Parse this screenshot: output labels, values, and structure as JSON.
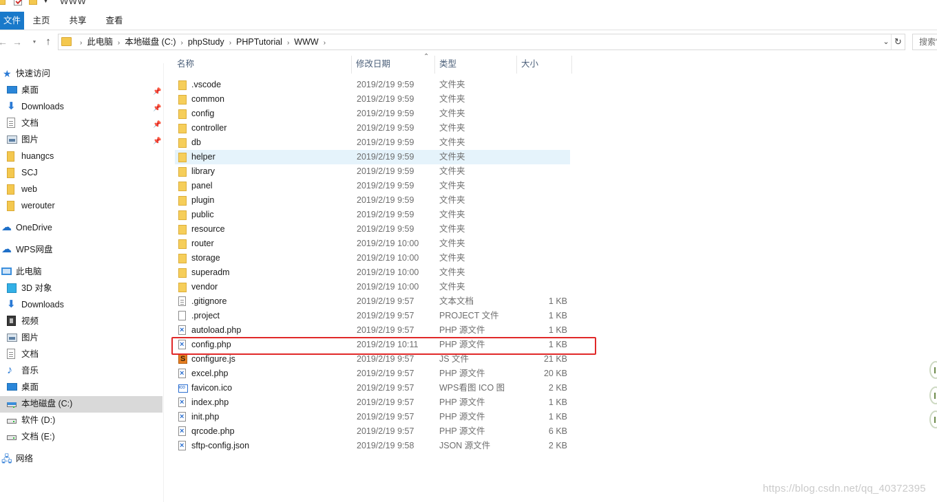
{
  "window": {
    "title": "WWW"
  },
  "ribbon": {
    "tabs": [
      "文件",
      "主页",
      "共享",
      "查看"
    ]
  },
  "address": {
    "segments": [
      "此电脑",
      "本地磁盘 (C:)",
      "phpStudy",
      "PHPTutorial",
      "WWW"
    ],
    "search_placeholder": "搜索\"WWW\""
  },
  "sidebar": {
    "items": [
      {
        "label": "快速访问",
        "icon": "star-icon"
      },
      {
        "label": "桌面",
        "icon": "desktop-icon",
        "pinned": true
      },
      {
        "label": "Downloads",
        "icon": "download-arrow-icon",
        "pinned": true
      },
      {
        "label": "文档",
        "icon": "document-icon",
        "pinned": true
      },
      {
        "label": "图片",
        "icon": "picture-icon",
        "pinned": true
      },
      {
        "label": "huangcs",
        "icon": "folder-icon"
      },
      {
        "label": "SCJ",
        "icon": "folder-icon"
      },
      {
        "label": "web",
        "icon": "folder-icon"
      },
      {
        "label": "werouter",
        "icon": "folder-icon"
      },
      {
        "label": "OneDrive",
        "icon": "cloud-icon"
      },
      {
        "label": "WPS网盘",
        "icon": "wps-cloud-icon"
      },
      {
        "label": "此电脑",
        "icon": "computer-icon"
      },
      {
        "label": "3D 对象",
        "icon": "3d-objects-icon"
      },
      {
        "label": "Downloads",
        "icon": "download-arrow-icon"
      },
      {
        "label": "视频",
        "icon": "video-icon"
      },
      {
        "label": "图片",
        "icon": "picture-icon"
      },
      {
        "label": "文档",
        "icon": "document-icon"
      },
      {
        "label": "音乐",
        "icon": "music-icon"
      },
      {
        "label": "桌面",
        "icon": "desktop-icon"
      },
      {
        "label": "本地磁盘 (C:)",
        "icon": "system-drive-icon",
        "selected": true
      },
      {
        "label": "软件 (D:)",
        "icon": "drive-icon"
      },
      {
        "label": "文档 (E:)",
        "icon": "drive-icon"
      },
      {
        "label": "网络",
        "icon": "network-icon"
      }
    ]
  },
  "columns": {
    "name": "名称",
    "date": "修改日期",
    "type": "类型",
    "size": "大小"
  },
  "files": [
    {
      "name": ".vscode",
      "date": "2019/2/19 9:59",
      "type": "文件夹",
      "size": "",
      "icon": "folder-icon"
    },
    {
      "name": "common",
      "date": "2019/2/19 9:59",
      "type": "文件夹",
      "size": "",
      "icon": "folder-icon"
    },
    {
      "name": "config",
      "date": "2019/2/19 9:59",
      "type": "文件夹",
      "size": "",
      "icon": "folder-icon"
    },
    {
      "name": "controller",
      "date": "2019/2/19 9:59",
      "type": "文件夹",
      "size": "",
      "icon": "folder-icon"
    },
    {
      "name": "db",
      "date": "2019/2/19 9:59",
      "type": "文件夹",
      "size": "",
      "icon": "folder-icon"
    },
    {
      "name": "helper",
      "date": "2019/2/19 9:59",
      "type": "文件夹",
      "size": "",
      "icon": "folder-icon",
      "hover": true
    },
    {
      "name": "library",
      "date": "2019/2/19 9:59",
      "type": "文件夹",
      "size": "",
      "icon": "folder-icon"
    },
    {
      "name": "panel",
      "date": "2019/2/19 9:59",
      "type": "文件夹",
      "size": "",
      "icon": "folder-icon"
    },
    {
      "name": "plugin",
      "date": "2019/2/19 9:59",
      "type": "文件夹",
      "size": "",
      "icon": "folder-icon"
    },
    {
      "name": "public",
      "date": "2019/2/19 9:59",
      "type": "文件夹",
      "size": "",
      "icon": "folder-icon"
    },
    {
      "name": "resource",
      "date": "2019/2/19 9:59",
      "type": "文件夹",
      "size": "",
      "icon": "folder-icon"
    },
    {
      "name": "router",
      "date": "2019/2/19 10:00",
      "type": "文件夹",
      "size": "",
      "icon": "folder-icon"
    },
    {
      "name": "storage",
      "date": "2019/2/19 10:00",
      "type": "文件夹",
      "size": "",
      "icon": "folder-icon"
    },
    {
      "name": "superadm",
      "date": "2019/2/19 10:00",
      "type": "文件夹",
      "size": "",
      "icon": "folder-icon"
    },
    {
      "name": "vendor",
      "date": "2019/2/19 10:00",
      "type": "文件夹",
      "size": "",
      "icon": "folder-icon"
    },
    {
      "name": ".gitignore",
      "date": "2019/2/19 9:57",
      "type": "文本文档",
      "size": "1 KB",
      "icon": "text-file-icon"
    },
    {
      "name": ".project",
      "date": "2019/2/19 9:57",
      "type": "PROJECT 文件",
      "size": "1 KB",
      "icon": "blank-file-icon"
    },
    {
      "name": "autoload.php",
      "date": "2019/2/19 9:57",
      "type": "PHP 源文件",
      "size": "1 KB",
      "icon": "php-file-icon"
    },
    {
      "name": "config.php",
      "date": "2019/2/19 10:11",
      "type": "PHP 源文件",
      "size": "1 KB",
      "icon": "php-file-icon",
      "highlighted": true
    },
    {
      "name": "configure.js",
      "date": "2019/2/19 9:57",
      "type": "JS 文件",
      "size": "21 KB",
      "icon": "js-file-icon"
    },
    {
      "name": "excel.php",
      "date": "2019/2/19 9:57",
      "type": "PHP 源文件",
      "size": "20 KB",
      "icon": "php-file-icon"
    },
    {
      "name": "favicon.ico",
      "date": "2019/2/19 9:57",
      "type": "WPS看图 ICO 图",
      "size": "2 KB",
      "icon": "ico-file-icon"
    },
    {
      "name": "index.php",
      "date": "2019/2/19 9:57",
      "type": "PHP 源文件",
      "size": "1 KB",
      "icon": "php-file-icon"
    },
    {
      "name": "init.php",
      "date": "2019/2/19 9:57",
      "type": "PHP 源文件",
      "size": "1 KB",
      "icon": "php-file-icon"
    },
    {
      "name": "qrcode.php",
      "date": "2019/2/19 9:57",
      "type": "PHP 源文件",
      "size": "6 KB",
      "icon": "php-file-icon"
    },
    {
      "name": "sftp-config.json",
      "date": "2019/2/19 9:58",
      "type": "JSON 源文件",
      "size": "2 KB",
      "icon": "php-file-icon"
    }
  ],
  "watermark": "https://blog.csdn.net/qq_40372395",
  "colors": {
    "accent": "#1979ca",
    "hover_row": "#e5f3fb",
    "selected_nav": "#d9d9d9",
    "highlight_box": "#e02828"
  }
}
